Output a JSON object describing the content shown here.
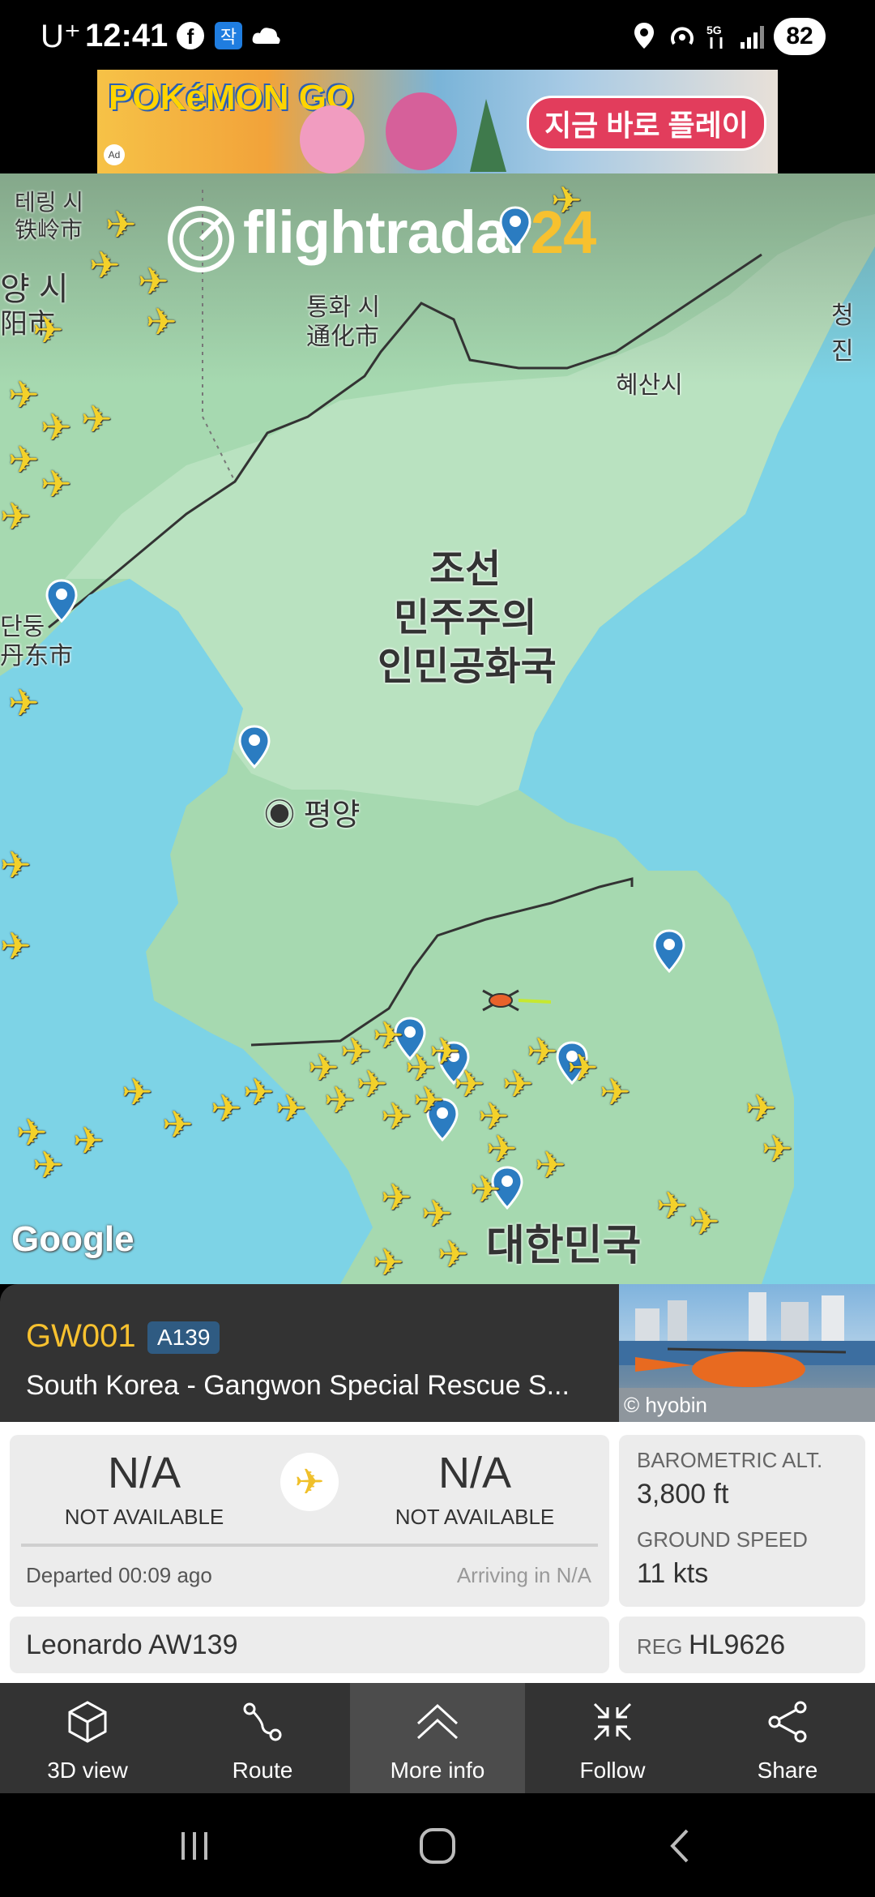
{
  "status_bar": {
    "carrier": "U⁺",
    "time": "12:41",
    "battery": "82",
    "network": "5G"
  },
  "ad": {
    "brand": "POKéMON GO",
    "cta": "지금 바로 플레이",
    "badge": "Ad"
  },
  "map": {
    "logo_main": "flightradar",
    "logo_num": "24",
    "labels": {
      "tieling": "테링 시",
      "tieling_cn": "铁岭市",
      "tonghua": "통화 시",
      "tonghua_cn": "通化市",
      "hyesan": "혜산시",
      "chongjin": "청진",
      "dandong": "단둥",
      "dandong_cn": "丹东市",
      "yang_city": "양 시",
      "yang_city_cn": "阳市",
      "north_korea_1": "조선",
      "north_korea_2": "민주주의",
      "north_korea_3": "인민공화국",
      "pyongyang": "평양",
      "south_korea": "대한민국"
    },
    "attribution": "Google"
  },
  "flight": {
    "callsign": "GW001",
    "aircraft_type": "A139",
    "airline": "South Korea - Gangwon Special Rescue S...",
    "photo_credit": "© hyobin",
    "origin_code": "N/A",
    "origin_name": "NOT AVAILABLE",
    "destination_code": "N/A",
    "destination_name": "NOT AVAILABLE",
    "departed": "Departed 00:09 ago",
    "arriving": "Arriving in N/A",
    "baro_alt_label": "BAROMETRIC ALT.",
    "baro_alt_value": "3,800 ft",
    "ground_speed_label": "GROUND SPEED",
    "ground_speed_value": "11 kts",
    "aircraft_model": "Leonardo AW139",
    "reg_label": "REG",
    "reg_value": "HL9626"
  },
  "toolbar": {
    "items": [
      {
        "label": "3D view",
        "icon": "cube-icon"
      },
      {
        "label": "Route",
        "icon": "route-icon"
      },
      {
        "label": "More info",
        "icon": "chevron-up-icon"
      },
      {
        "label": "Follow",
        "icon": "follow-icon"
      },
      {
        "label": "Share",
        "icon": "share-icon"
      }
    ]
  },
  "colors": {
    "accent": "#f7c12f",
    "panel": "#333333",
    "badge": "#2f5b82"
  }
}
